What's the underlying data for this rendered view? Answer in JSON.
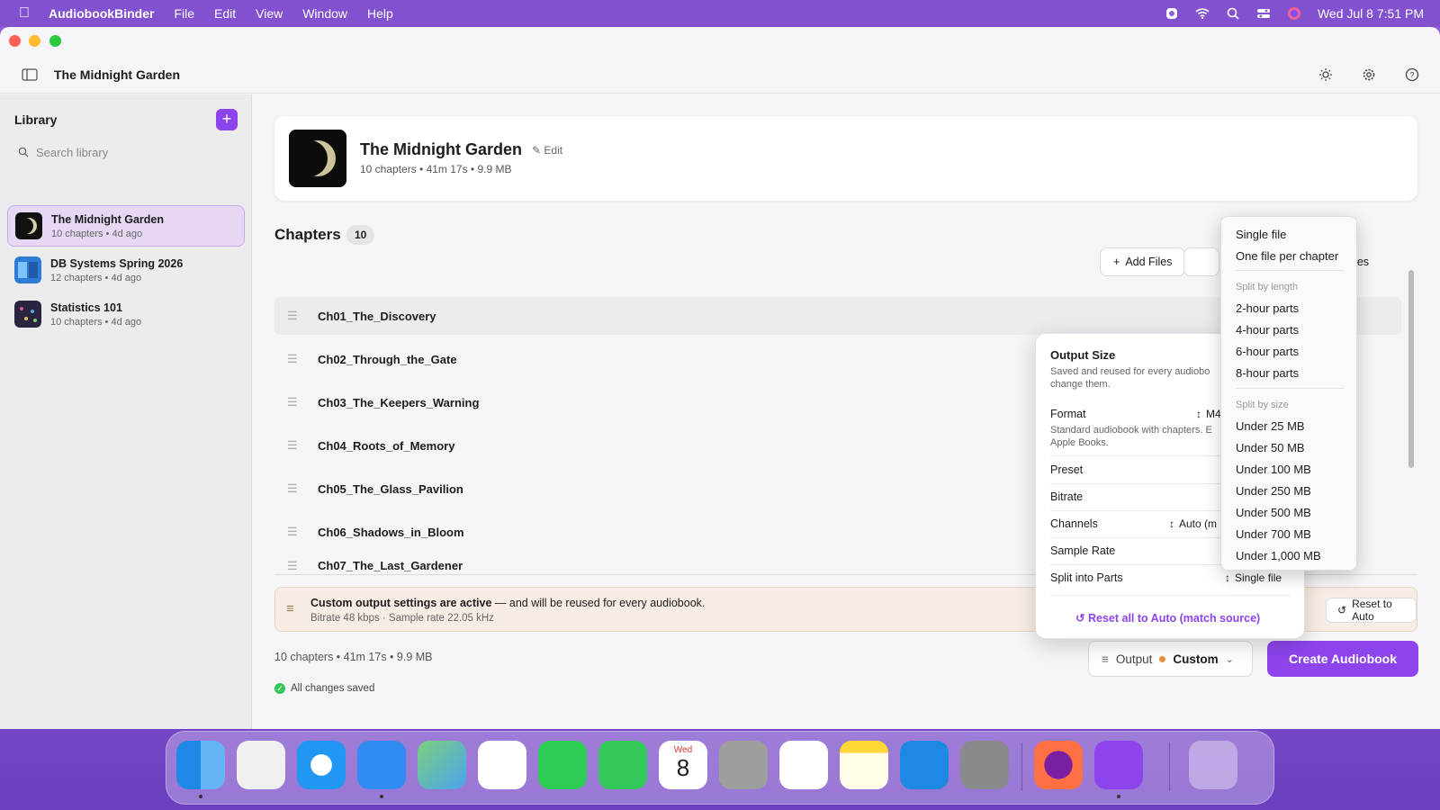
{
  "menubar": {
    "app_name": "AudiobookBinder",
    "menus": [
      "File",
      "Edit",
      "View",
      "Window",
      "Help"
    ],
    "clock": "Wed Jul 8  7:51 PM"
  },
  "toolbar": {
    "title": "The Midnight Garden"
  },
  "sidebar": {
    "heading": "Library",
    "add_label": "+",
    "search_placeholder": "Search library",
    "items": [
      {
        "name": "The Midnight Garden",
        "meta": "10 chapters • 4d ago"
      },
      {
        "name": "DB Systems Spring 2026",
        "meta": "12 chapters • 4d ago"
      },
      {
        "name": "Statistics 101",
        "meta": "10 chapters • 4d ago"
      }
    ]
  },
  "hero": {
    "title": "The Midnight Garden",
    "edit_label": "Edit",
    "meta": "10 chapters • 41m 17s • 9.9 MB"
  },
  "chapters": {
    "heading": "Chapters",
    "count": "10",
    "add_files_label": "Add Files",
    "names_btn_label": "p Names",
    "items": [
      "Ch01_The_Discovery",
      "Ch02_Through_the_Gate",
      "Ch03_The_Keepers_Warning",
      "Ch04_Roots_of_Memory",
      "Ch05_The_Glass_Pavilion",
      "Ch06_Shadows_in_Bloom",
      "Ch07_The_Last_Gardener"
    ]
  },
  "banner": {
    "title_bold": "Custom output settings are active",
    "title_rest": " — and will be reused for every audiobook.",
    "subtitle": "Bitrate 48 kbps · Sample rate 22.05 kHz",
    "reset_label": "Reset to Auto"
  },
  "footer": {
    "meta": "10 chapters • 41m 17s • 9.9 MB",
    "saved": "All changes saved",
    "output_label": "Output",
    "output_value": "Custom",
    "create_label": "Create Audiobook"
  },
  "popover": {
    "title": "Output Size",
    "desc": "Saved and reused for every audiobo change them.",
    "format_label": "Format",
    "format_value": "M4",
    "format_desc": "Standard audiobook with chapters. E Apple Books.",
    "preset_label": "Preset",
    "bitrate_label": "Bitrate",
    "channels_label": "Channels",
    "channels_value": "Auto (m",
    "sample_rate_label": "Sample Rate",
    "split_label": "Split into Parts",
    "split_value": "Single file",
    "reset_all_label": "Reset all to Auto (match source)"
  },
  "dropdown": {
    "top_items": [
      "Single file",
      "One file per chapter"
    ],
    "length_heading": "Split by length",
    "length_items": [
      "2-hour parts",
      "4-hour parts",
      "6-hour parts",
      "8-hour parts"
    ],
    "size_heading": "Split by size",
    "size_items": [
      "Under 25 MB",
      "Under 50 MB",
      "Under 100 MB",
      "Under 250 MB",
      "Under 500 MB",
      "Under 700 MB",
      "Under 1,000 MB"
    ]
  },
  "dock": {
    "calendar_day": "Wed",
    "calendar_date": "8"
  },
  "colors": {
    "accent": "#8e44ec",
    "banner_bg": "#f7ede4",
    "custom_dot": "#e8913a"
  }
}
